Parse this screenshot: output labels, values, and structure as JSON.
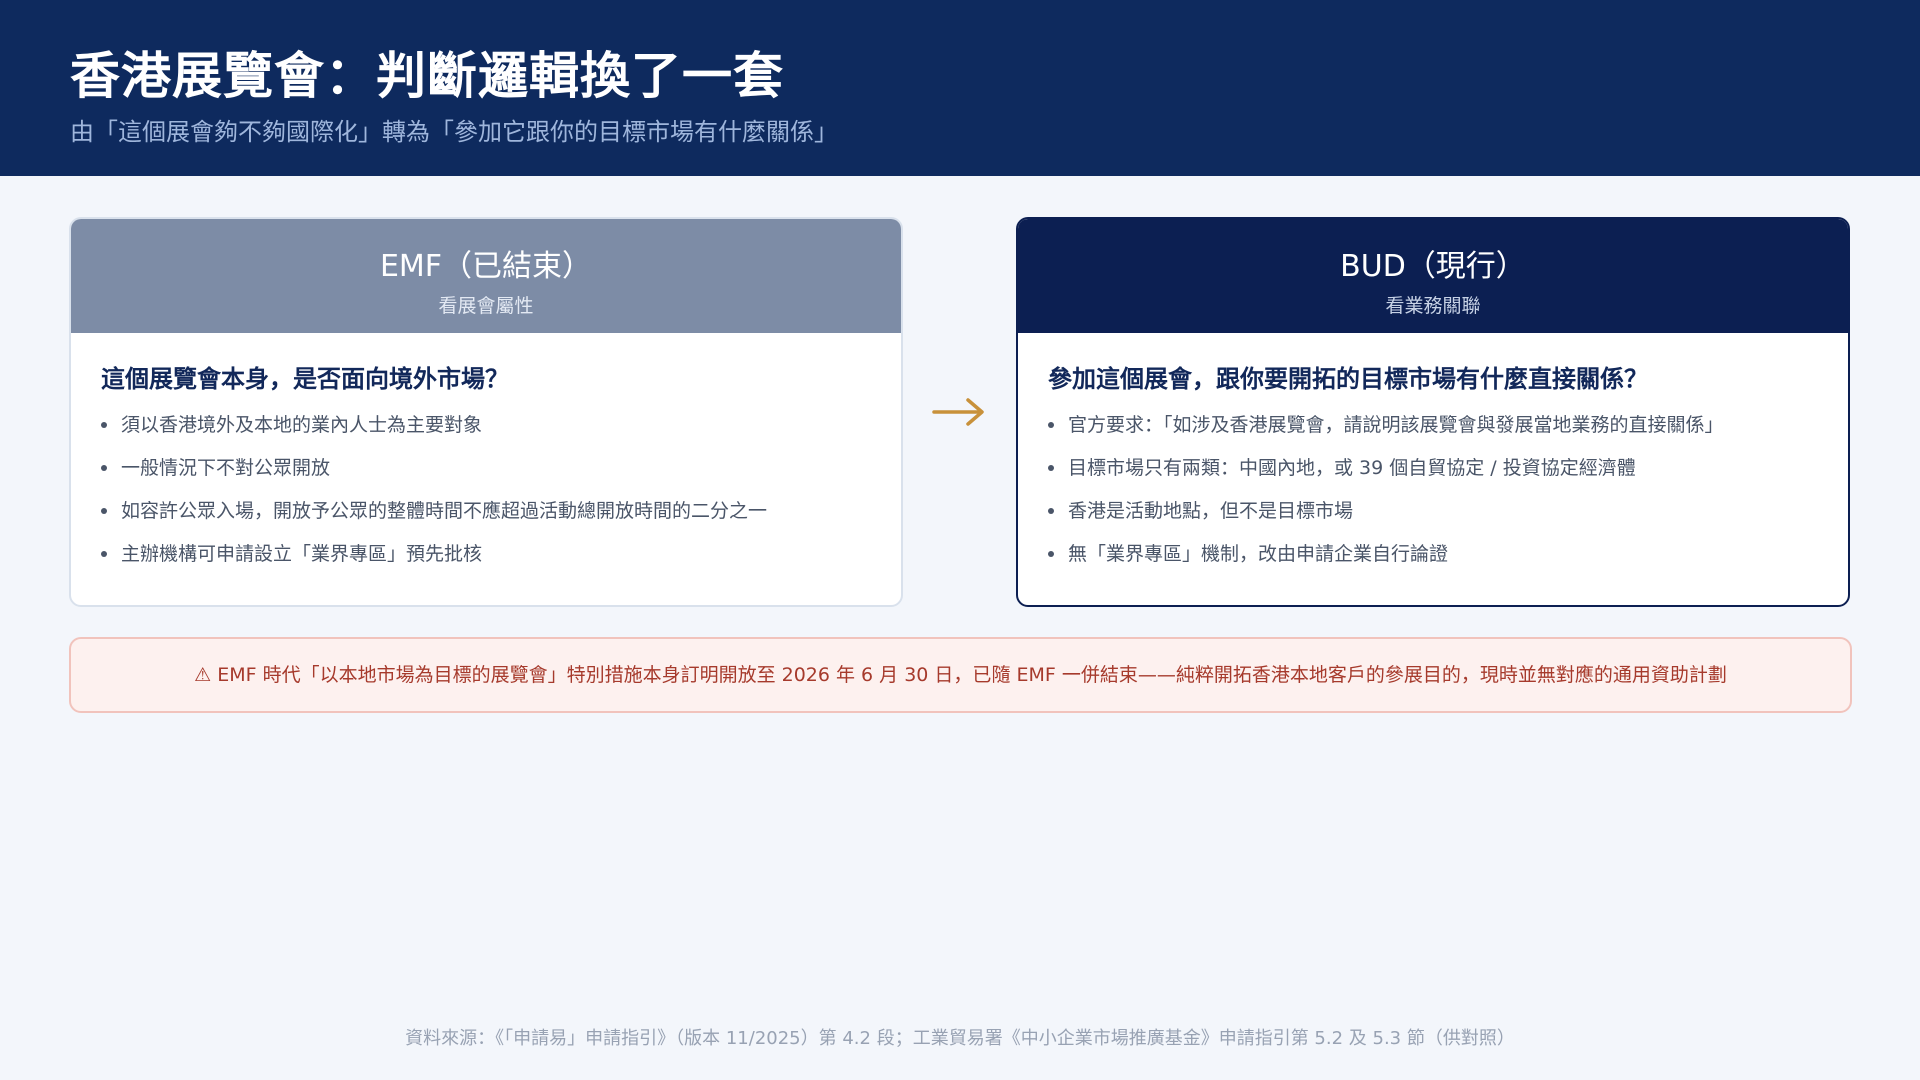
{
  "header": {
    "title": "香港展覽會：判斷邏輯換了一套",
    "subtitle": "由「這個展會夠不夠國際化」轉為「參加它跟你的目標市場有什麼關係」"
  },
  "emf": {
    "title": "EMF（已結束）",
    "tag": "看展會屬性",
    "question": "這個展覽會本身，是否面向境外市場？",
    "bullets": [
      "須以香港境外及本地的業內人士為主要對象",
      "一般情況下不對公眾開放",
      "如容許公眾入場，開放予公眾的整體時間不應超過活動總開放時間的二分之一",
      "主辦機構可申請設立「業界專區」預先批核"
    ]
  },
  "bud": {
    "title": "BUD（現行）",
    "tag": "看業務關聯",
    "question": "參加這個展會，跟你要開拓的目標市場有什麼直接關係？",
    "bullets": [
      "官方要求：「如涉及香港展覽會，請說明該展覽會與發展當地業務的直接關係」",
      "目標市場只有兩類：中國內地，或 39 個自貿協定 / 投資協定經濟體",
      "香港是活動地點，但不是目標市場",
      "無「業界專區」機制，改由申請企業自行論證"
    ]
  },
  "arrow": {
    "icon": "arrow-right-icon",
    "color": "#c8913a"
  },
  "notice": {
    "icon": "warning-icon",
    "text": "⚠ EMF 時代「以本地市場為目標的展覽會」特別措施本身訂明開放至 2026 年 6 月 30 日，已隨 EMF 一併結束——純粹開拓香港本地客戶的參展目的，現時並無對應的通用資助計劃"
  },
  "footer": {
    "source": "資料來源：《「申請易」申請指引》（版本 11/2025）第 4.2 段；工業貿易署《中小企業市場推廣基金》申請指引第 5.2 及 5.3 節（供對照）"
  },
  "colors": {
    "header_bg": "#0e2a5e",
    "emf_head": "#7d8ca6",
    "bud_head": "#0c1f52",
    "notice_text": "#a63a2c",
    "notice_bg": "#fdf1ef"
  }
}
